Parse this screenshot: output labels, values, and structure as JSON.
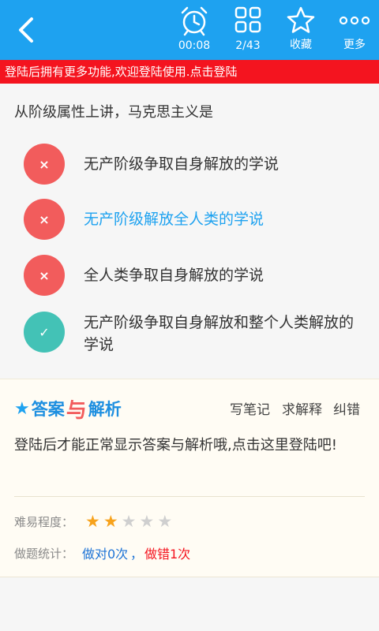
{
  "toolbar": {
    "timer_label": "00:08",
    "progress_label": "2/43",
    "favorite_label": "收藏",
    "more_label": "更多"
  },
  "login_banner": "登陆后拥有更多功能,欢迎登陆使用.点击登陆",
  "question": "从阶级属性上讲，马克思主义是",
  "options": [
    {
      "mark": "×",
      "text": "无产阶级争取自身解放的学说",
      "state": "wrong"
    },
    {
      "mark": "×",
      "text": "无产阶级解放全人类的学说",
      "state": "wrong-selected"
    },
    {
      "mark": "×",
      "text": "全人类争取自身解放的学说",
      "state": "wrong"
    },
    {
      "mark": "✓",
      "text": "无产阶级争取自身解放和整个人类解放的学说",
      "state": "correct"
    }
  ],
  "analysis": {
    "title_part1": "答案",
    "title_amp": "与",
    "title_part2": "解析",
    "actions": [
      "写笔记",
      "求解释",
      "纠错"
    ],
    "message": "登陆后才能正常显示答案与解析哦,点击这里登陆吧!",
    "difficulty_label": "难易程度：",
    "difficulty_rating": 2,
    "difficulty_max": 5,
    "stats_label": "做题统计：",
    "correct_text": "做对0次",
    "separator": "，",
    "wrong_text": "做错1次"
  },
  "colors": {
    "primary": "#1ea2f0",
    "banner_red": "#f4141f",
    "wrong": "#f25c5c",
    "correct": "#43c2b6",
    "star_on": "#f7a21b",
    "star_off": "#cfcfcf",
    "stat_red": "#f4141f"
  }
}
